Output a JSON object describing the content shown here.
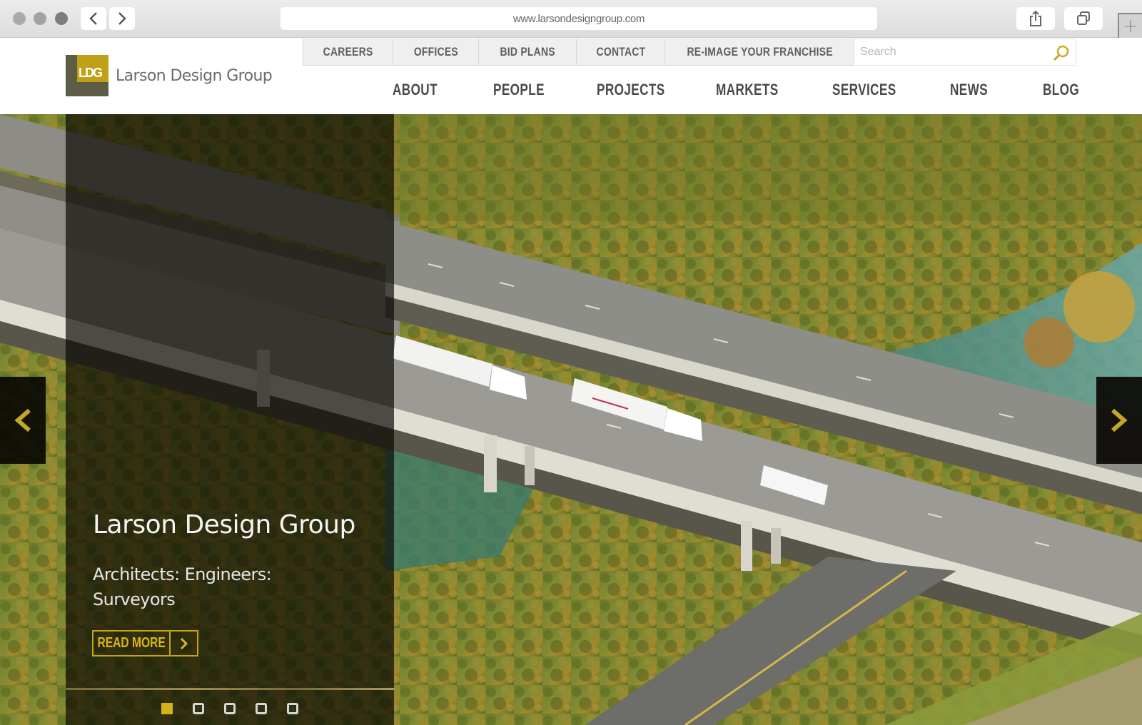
{
  "browser": {
    "url": "www.larsondesigngroup.com",
    "back_icon": "chevron-left-icon",
    "forward_icon": "chevron-right-icon",
    "share_icon": "share-icon",
    "tabs_icon": "tabs-overview-icon",
    "new_tab_icon": "plus-icon"
  },
  "site": {
    "logo_mark": "LDG",
    "logo_text": "Larson Design Group",
    "brand_gold": "#bfa017",
    "brand_olive": "#5c5c47"
  },
  "utility_nav": [
    {
      "label": "CAREERS"
    },
    {
      "label": "OFFICES"
    },
    {
      "label": "BID PLANS"
    },
    {
      "label": "CONTACT"
    },
    {
      "label": "RE-IMAGE YOUR FRANCHISE"
    }
  ],
  "search": {
    "placeholder": "Search",
    "value": "",
    "icon": "search-icon"
  },
  "main_nav": [
    {
      "label": "ABOUT"
    },
    {
      "label": "PEOPLE"
    },
    {
      "label": "PROJECTS"
    },
    {
      "label": "MARKETS"
    },
    {
      "label": "SERVICES"
    },
    {
      "label": "NEWS"
    },
    {
      "label": "BLOG"
    }
  ],
  "hero": {
    "title": "Larson Design Group",
    "subtitle": "Architects: Engineers: Surveyors",
    "cta_label": "READ MORE",
    "cta_icon": "chevron-right-icon",
    "prev_icon": "chevron-left-icon",
    "next_icon": "chevron-right-icon",
    "image_description": "Aerial view of highway bridges with trucks over a river and autumn trees",
    "slides_total": 5,
    "active_slide": 1
  }
}
